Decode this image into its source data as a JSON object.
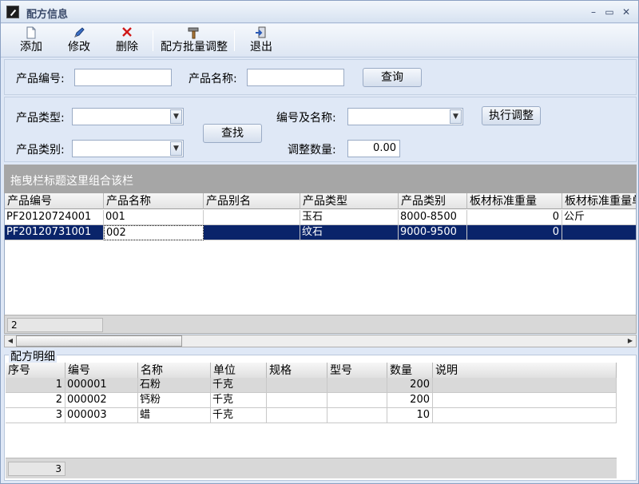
{
  "window": {
    "title": "配方信息"
  },
  "window_controls": {
    "minimize": "–",
    "maximize": "▭",
    "close": "✕"
  },
  "toolbar": {
    "add": "添加",
    "edit": "修改",
    "delete": "删除",
    "batch_adjust": "配方批量调整",
    "exit": "退出"
  },
  "query": {
    "product_code_label": "产品编号:",
    "product_code_value": "",
    "product_name_label": "产品名称:",
    "product_name_value": "",
    "search_button": "查询"
  },
  "adjust": {
    "product_type_label": "产品类型:",
    "product_type_value": "",
    "product_category_label": "产品类别:",
    "product_category_value": "",
    "find_button": "查找",
    "code_and_name_label": "编号及名称:",
    "code_and_name_value": "",
    "adjust_qty_label": "调整数量:",
    "adjust_qty_value": "0.00",
    "execute_button": "执行调整"
  },
  "grid1": {
    "group_hint": "拖曳栏标题这里组合该栏",
    "columns": [
      "产品编号",
      "产品名称",
      "产品别名",
      "产品类型",
      "产品类别",
      "板材标准重量",
      "板材标准重量单"
    ],
    "rows": [
      [
        "PF20120724001",
        "001",
        "",
        "玉石",
        "8000-8500",
        "0",
        "公斤"
      ],
      [
        "PF20120731001",
        "002",
        "",
        "纹石",
        "9000-9500",
        "0",
        ""
      ]
    ],
    "selected_row": 1,
    "footer_count": "2"
  },
  "detail": {
    "title": "配方明细",
    "columns": [
      "序号",
      "编号",
      "名称",
      "单位",
      "规格",
      "型号",
      "数量",
      "说明"
    ],
    "rows": [
      [
        "1",
        "000001",
        "石粉",
        "千克",
        "",
        "",
        "200",
        ""
      ],
      [
        "2",
        "000002",
        "钙粉",
        "千克",
        "",
        "",
        "200",
        ""
      ],
      [
        "3",
        "000003",
        "蜡",
        "千克",
        "",
        "",
        "10",
        ""
      ]
    ],
    "footer_count": "3"
  },
  "icons": {
    "add": "new-file-icon",
    "edit": "pencil-icon",
    "delete": "red-x-icon",
    "batch_adjust": "hammer-icon",
    "exit": "exit-door-icon"
  },
  "colors": {
    "selected_row": "#0a246a",
    "group_band": "#a6a6a6",
    "panel_bg": "#dfe8f6"
  }
}
